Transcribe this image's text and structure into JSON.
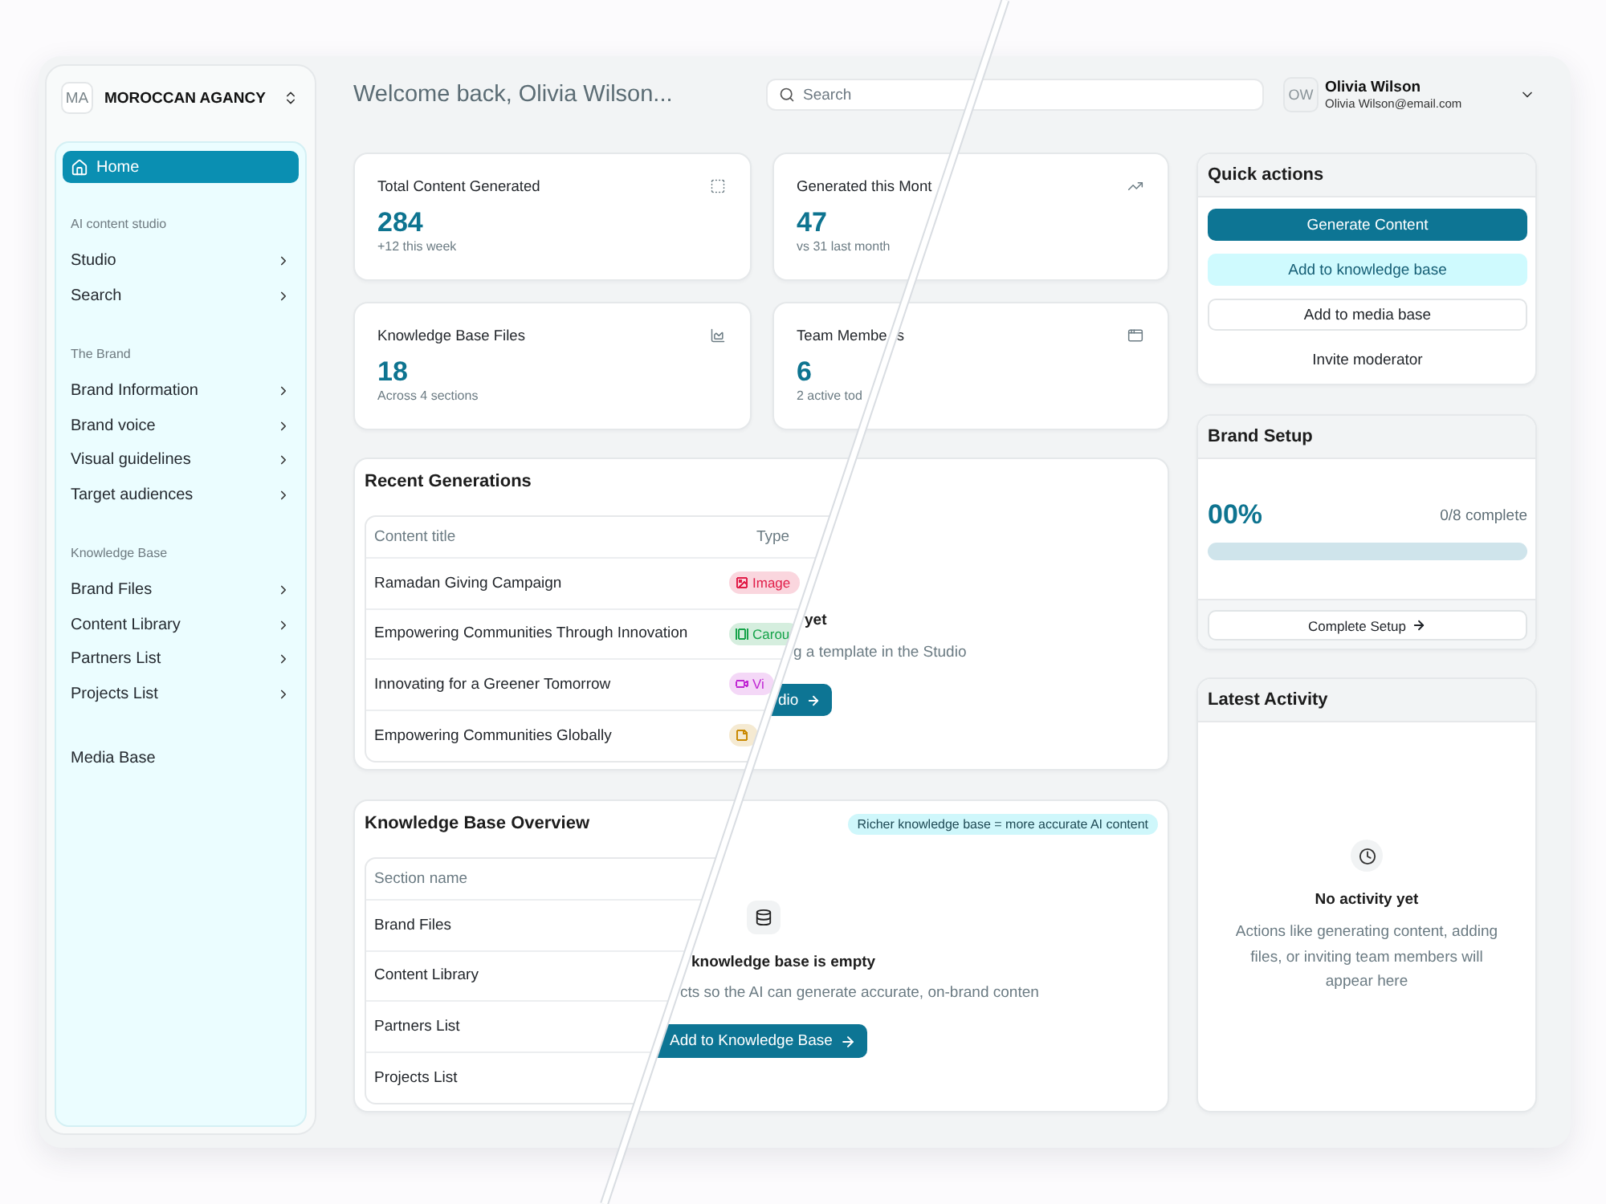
{
  "sidebar": {
    "org": {
      "initials": "MA",
      "name": "MOROCCAN AGANCY"
    },
    "home": {
      "label": "Home",
      "selected": true
    },
    "sections": [
      {
        "label": "AI content studio",
        "items": [
          {
            "label": "Studio",
            "expandable": true,
            "selected": false
          },
          {
            "label": "Search",
            "expandable": true,
            "selected": false
          }
        ]
      },
      {
        "label": "The Brand",
        "items": [
          {
            "label": "Brand Information",
            "expandable": true,
            "selected": false
          },
          {
            "label": "Brand voice",
            "expandable": true,
            "selected": false
          },
          {
            "label": "Visual guidelines",
            "expandable": true,
            "selected": false
          },
          {
            "label": "Target audiences",
            "expandable": true,
            "selected": false
          }
        ]
      },
      {
        "label": "Knowledge Base",
        "items": [
          {
            "label": "Brand Files",
            "expandable": true,
            "selected": false
          },
          {
            "label": "Content Library",
            "expandable": true,
            "selected": false
          },
          {
            "label": "Partners List",
            "expandable": true,
            "selected": false
          },
          {
            "label": "Projects List",
            "expandable": true,
            "selected": false
          }
        ]
      },
      {
        "items": [
          {
            "label": "Media Base",
            "expandable": false,
            "selected": false
          }
        ]
      }
    ]
  },
  "header": {
    "greeting": "Welcome back, Olivia Wilson...",
    "search": {
      "placeholder": "Search"
    },
    "user": {
      "initials": "OW",
      "name": "Olivia Wilson",
      "email": "Olivia Wilson@email.com"
    }
  },
  "stats": [
    {
      "title_parts": [
        "Total Content Generated"
      ],
      "value": "284",
      "note": "+12 this week"
    },
    {
      "title_parts": [
        "Generated this Mont"
      ],
      "value": "47",
      "note": "vs 31 last month"
    },
    {
      "title_parts": [
        "Knowledge Base Files"
      ],
      "value": "18",
      "note": "Across 4 sections"
    },
    {
      "title_parts": [
        "Team Membe",
        "s"
      ],
      "value": "6",
      "note": "2 active tod"
    }
  ],
  "recent_generations": {
    "title": "Recent Generations",
    "columns": [
      "Content title",
      "Type"
    ],
    "rows": [
      {
        "title": "Ramadan Giving Campaign",
        "type": {
          "label": "Image",
          "color": "#e11d48"
        }
      },
      {
        "title": "Empowering Communities Through Innovation",
        "type": {
          "label": "Carou",
          "color": "#16a34a"
        }
      },
      {
        "title": "Innovating for a Greener Tomorrow",
        "type": {
          "label": "Vi",
          "color": "#c026d3"
        }
      },
      {
        "title": "Empowering Communities Globally",
        "type": {
          "color": "#ca8a04"
        }
      }
    ],
    "empty_state": {
      "title": "yet",
      "text": "g a template in the Studio",
      "button": "dio"
    }
  },
  "knowledge_base": {
    "title": "Knowledge Base Overview",
    "tip": "Richer knowledge base = more accurate AI content",
    "columns": [
      "Section name"
    ],
    "rows": [
      "Brand Files",
      "Content Library",
      "Partners List",
      "Projects List"
    ],
    "empty_state": {
      "title": "knowledge base is empty",
      "text": "cts so the AI can generate accurate, on-brand conten",
      "button": "Add to Knowledge Base"
    }
  },
  "quick_actions": {
    "title": "Quick actions",
    "actions": [
      {
        "label": "Generate Content",
        "kind": "primary"
      },
      {
        "label": "Add to knowledge base",
        "kind": "secondary"
      },
      {
        "label": "Add to media base",
        "kind": "outline"
      },
      {
        "label": "Invite moderator",
        "kind": "plain"
      }
    ]
  },
  "brand_setup": {
    "title": "Brand Setup",
    "percent": "00%",
    "progress": "0/8 complete",
    "button": "Complete Setup"
  },
  "latest_activity": {
    "title": "Latest Activity",
    "empty_title": "No activity yet",
    "empty_text": "Actions like generating content, adding files, or inviting team members will appear here"
  }
}
